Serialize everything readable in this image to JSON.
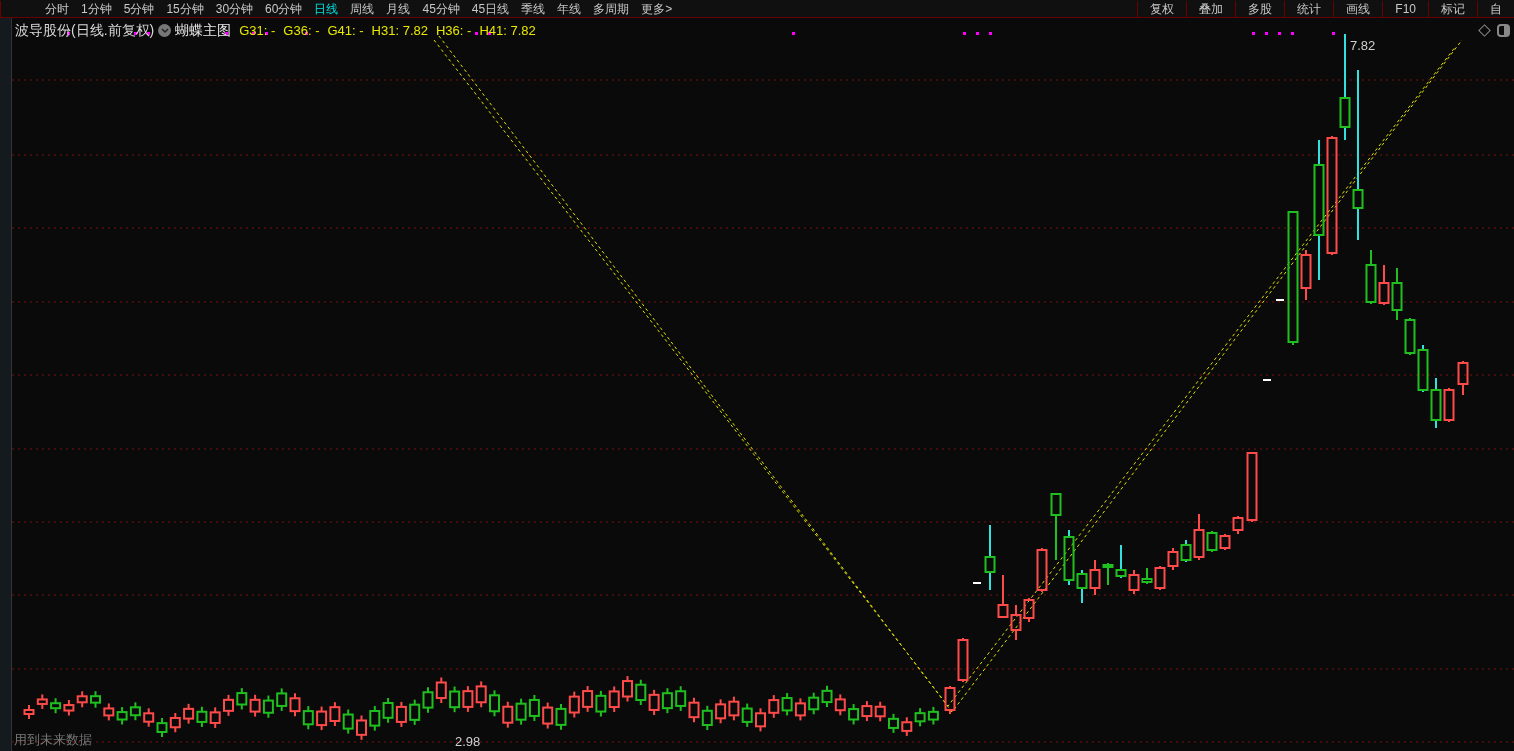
{
  "toolbar_left": [
    {
      "label": "分时",
      "selected": false
    },
    {
      "label": "1分钟",
      "selected": false
    },
    {
      "label": "5分钟",
      "selected": false
    },
    {
      "label": "15分钟",
      "selected": false
    },
    {
      "label": "30分钟",
      "selected": false
    },
    {
      "label": "60分钟",
      "selected": false
    },
    {
      "label": "日线",
      "selected": true
    },
    {
      "label": "周线",
      "selected": false
    },
    {
      "label": "月线",
      "selected": false
    },
    {
      "label": "45分钟",
      "selected": false
    },
    {
      "label": "45日线",
      "selected": false
    },
    {
      "label": "季线",
      "selected": false
    },
    {
      "label": "年线",
      "selected": false
    },
    {
      "label": "多周期",
      "selected": false
    },
    {
      "label": "更多>",
      "selected": false
    }
  ],
  "toolbar_right": [
    "复权",
    "叠加",
    "多股",
    "统计",
    "画线",
    "F10",
    "标记",
    "自"
  ],
  "chart_header": {
    "title": "波导股份(日线.前复权)",
    "indicator": "蝴蝶主图",
    "values": [
      "G31: -",
      "G36: -",
      "G41: -",
      "H31: 7.82",
      "H36: -",
      "H41: 7.82"
    ]
  },
  "price_labels": {
    "high": "7.82",
    "low": "2.98"
  },
  "footnote": "用到未来数据"
}
